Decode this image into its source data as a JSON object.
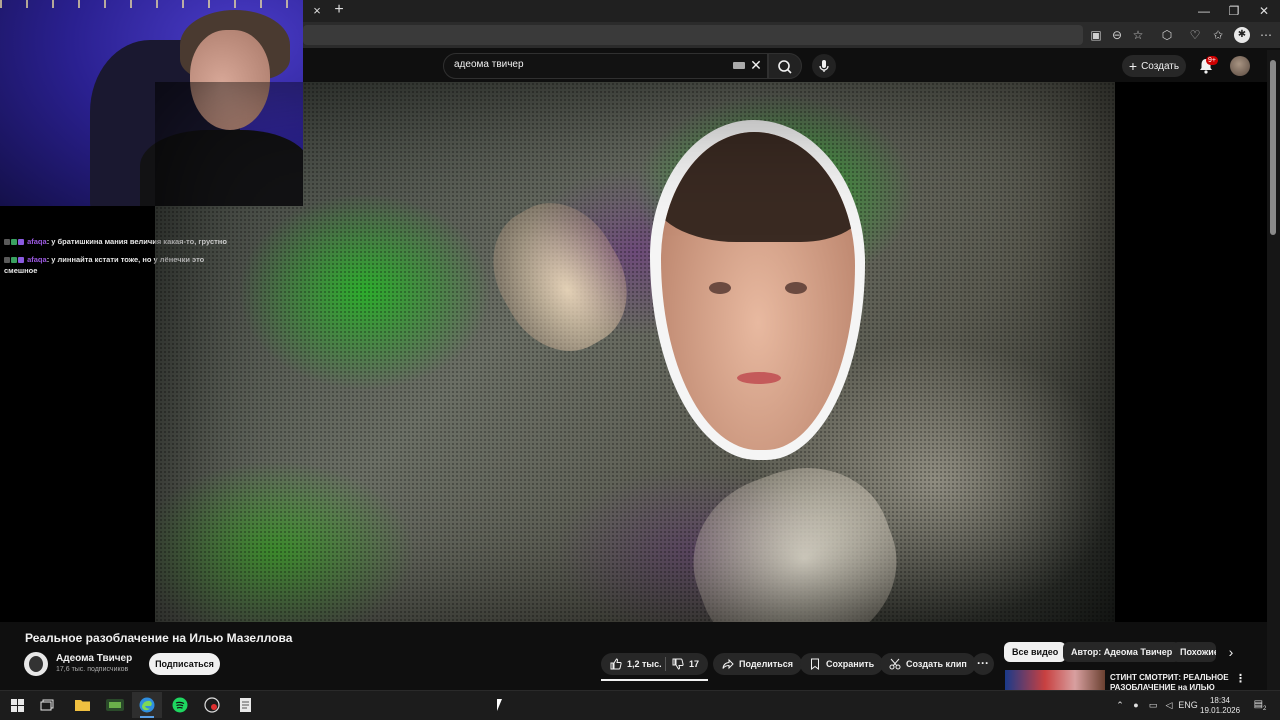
{
  "browser": {
    "tab_close_glyph": "×",
    "new_tab_glyph": "+",
    "window_controls": [
      "—",
      "❐",
      "✕"
    ]
  },
  "youtube": {
    "search": {
      "query": "адеома твичер"
    },
    "create_label": "Создать",
    "notification_badge": "9+"
  },
  "chat": {
    "messages": [
      {
        "user": "afaqa",
        "text": "у братишкина мания величия какая-то, грустно"
      },
      {
        "user": "afaqa",
        "text": "у линнайта кстати тоже, но у лёнечки это смешное"
      }
    ]
  },
  "video": {
    "title": "Реальное разоблачение на Илью Мазеллова",
    "channel": {
      "name": "Адеома Твичер",
      "subscribers": "17,6 тыс. подписчиков"
    },
    "subscribe_label": "Подписаться",
    "likes": "1,2 тыс.",
    "dislikes": "17",
    "share_label": "Поделиться",
    "save_label": "Сохранить",
    "clip_label": "Создать клип",
    "more_glyph": "···"
  },
  "sidebar": {
    "chips": [
      "Все видео",
      "Автор: Адеома Твичер",
      "Похожие"
    ],
    "next_glyph": "›",
    "recommendation": {
      "title": "СТИНТ СМОТРИТ: РЕАЛЬНОЕ РАЗОБЛАЧЕНИЕ на ИЛЬЮ"
    }
  },
  "taskbar": {
    "language": "ENG",
    "time": "18:34",
    "date": "19.01.2026",
    "notification_count": "2"
  },
  "colors": {
    "youtube_bg": "#0f0f0f",
    "pill_bg": "#272727",
    "badge_red": "#cc0000",
    "chat_username": "#9b59e0",
    "spotify_green": "#1ed760",
    "edge_blue": "#2f8ee0"
  }
}
